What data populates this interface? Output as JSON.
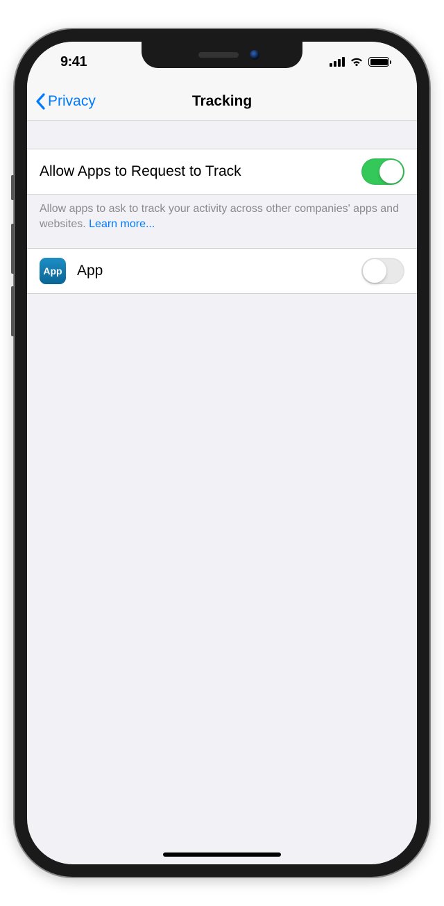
{
  "statusBar": {
    "time": "9:41"
  },
  "nav": {
    "back": "Privacy",
    "title": "Tracking"
  },
  "allowTrack": {
    "label": "Allow Apps to Request to Track",
    "on": true,
    "footer": "Allow apps to ask to track your activity across other companies' apps and websites. ",
    "learnMore": "Learn more..."
  },
  "apps": [
    {
      "iconText": "App",
      "name": "App",
      "on": false
    }
  ]
}
